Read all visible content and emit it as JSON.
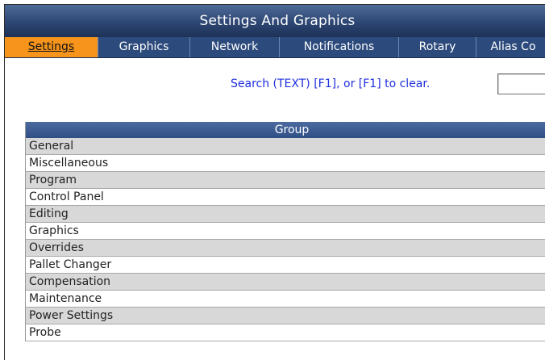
{
  "window": {
    "title": "Settings And Graphics"
  },
  "tabs": [
    {
      "label": "Settings",
      "active": true
    },
    {
      "label": "Graphics",
      "active": false
    },
    {
      "label": "Network",
      "active": false
    },
    {
      "label": "Notifications",
      "active": false
    },
    {
      "label": "Rotary",
      "active": false
    },
    {
      "label": "Alias Co",
      "active": false
    }
  ],
  "search": {
    "label": "Search (TEXT) [F1], or [F1] to clear.",
    "value": ""
  },
  "table": {
    "header": "Group",
    "rows": [
      "General",
      "Miscellaneous",
      "Program",
      "Control Panel",
      "Editing",
      "Graphics",
      "Overrides",
      "Pallet Changer",
      "Compensation",
      "Maintenance",
      "Power Settings",
      "Probe"
    ]
  },
  "colors": {
    "active_tab": "#f6941c",
    "tab_bar": "#2c4a7c",
    "search_text": "#1f2fdc"
  }
}
